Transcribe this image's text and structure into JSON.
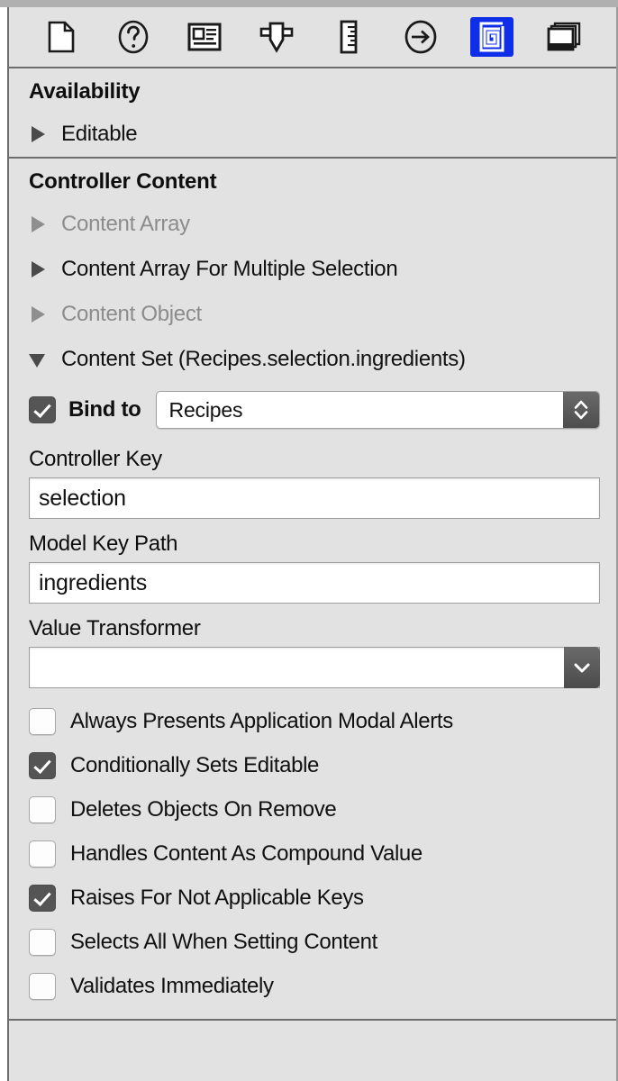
{
  "window": {
    "panel_background": "#e2e2e2",
    "accent_selected": "#0f2ee8"
  },
  "inspector_toolbar": {
    "buttons": [
      {
        "name": "file-inspector",
        "icon": "document-icon",
        "selected": false
      },
      {
        "name": "quick-help-inspector",
        "icon": "question-circle-icon",
        "selected": false
      },
      {
        "name": "identity-inspector",
        "icon": "id-card-icon",
        "selected": false
      },
      {
        "name": "attributes-inspector",
        "icon": "down-arrow-slider-icon",
        "selected": false
      },
      {
        "name": "size-inspector",
        "icon": "ruler-icon",
        "selected": false
      },
      {
        "name": "connections-inspector",
        "icon": "arrow-circle-right-icon",
        "selected": false
      },
      {
        "name": "bindings-inspector",
        "icon": "spiral-icon",
        "selected": true
      },
      {
        "name": "view-effects-inspector",
        "icon": "layered-window-icon",
        "selected": false
      }
    ]
  },
  "availability": {
    "header": "Availability",
    "rows": [
      {
        "label": "Editable",
        "expanded": false,
        "dimmed": false
      }
    ]
  },
  "controller_content": {
    "header": "Controller Content",
    "rows": [
      {
        "label": "Content Array",
        "expanded": false,
        "dimmed": true
      },
      {
        "label": "Content Array For Multiple Selection",
        "expanded": false,
        "dimmed": false
      },
      {
        "label": "Content Object",
        "expanded": false,
        "dimmed": true
      },
      {
        "label": "Content Set (Recipes.selection.ingredients)",
        "expanded": true,
        "dimmed": false
      }
    ],
    "bind_to": {
      "checkbox_label": "Bind to",
      "checked": true,
      "popup_value": "Recipes",
      "popup_icon": "up-down-chevrons-icon"
    },
    "controller_key": {
      "label": "Controller Key",
      "value": "selection",
      "placeholder": ""
    },
    "model_key_path": {
      "label": "Model Key Path",
      "value": "ingredients",
      "placeholder": ""
    },
    "value_transformer": {
      "label": "Value Transformer",
      "value": "",
      "placeholder": "",
      "button_icon": "chevron-down-icon"
    },
    "options": [
      {
        "label": "Always Presents Application Modal Alerts",
        "checked": false
      },
      {
        "label": "Conditionally Sets Editable",
        "checked": true
      },
      {
        "label": "Deletes Objects On Remove",
        "checked": false
      },
      {
        "label": "Handles Content As Compound Value",
        "checked": false
      },
      {
        "label": "Raises For Not Applicable Keys",
        "checked": true
      },
      {
        "label": "Selects All When Setting Content",
        "checked": false
      },
      {
        "label": "Validates Immediately",
        "checked": false
      }
    ]
  }
}
